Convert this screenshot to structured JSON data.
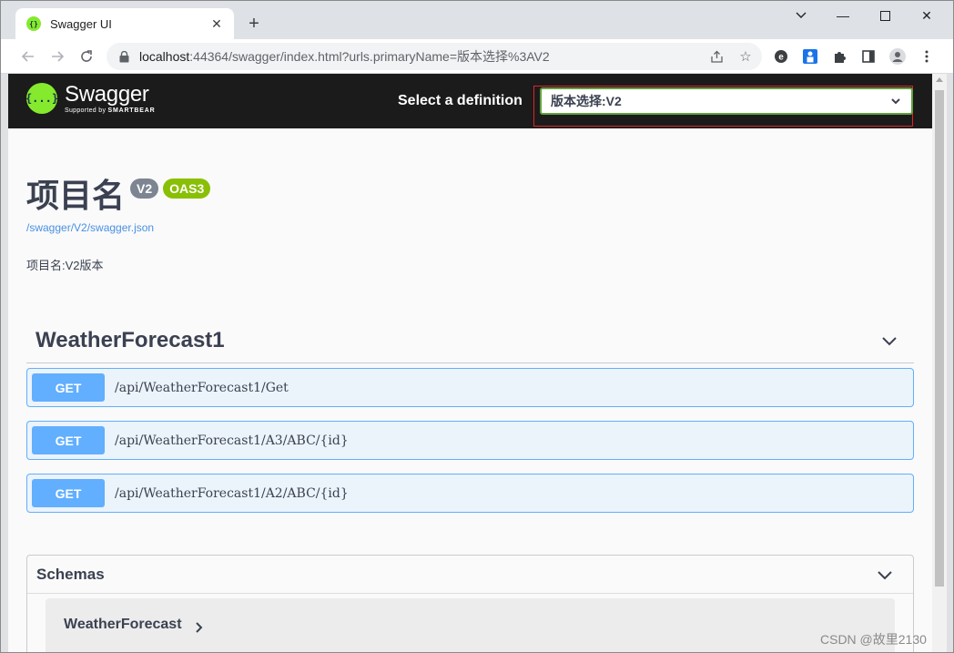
{
  "browser": {
    "tab_title": "Swagger UI",
    "tab_close": "✕",
    "new_tab": "+",
    "url_host": "localhost",
    "url_rest": ":44364/swagger/index.html?urls.primaryName=版本选择%3AV2",
    "window_controls": {
      "minimize": "—",
      "restore": "❐",
      "close": "✕"
    },
    "icons": [
      "back-icon",
      "forward-icon",
      "reload-icon",
      "lock-icon",
      "share-icon",
      "bookmark-star-icon",
      "extension-icon",
      "puzzle-icon",
      "sidebar-icon",
      "profile-icon",
      "more-icon"
    ]
  },
  "topbar": {
    "logo_word": "Swagger",
    "logo_sub_prefix": "Supported by",
    "logo_sub_brand": "SMARTBEAR",
    "logo_mark": "{...}",
    "definition_label": "Select a definition",
    "definition_value": "版本选择:V2",
    "accent_color": "#85ea2d",
    "highlight_color": "#e02424"
  },
  "info": {
    "title": "项目名",
    "version_badge": "V2",
    "oas_badge": "OAS3",
    "spec_link": "/swagger/V2/swagger.json",
    "description": "项目名:V2版本"
  },
  "tag": {
    "name": "WeatherForecast1",
    "operations": [
      {
        "method": "GET",
        "path": "/api/WeatherForecast1/Get"
      },
      {
        "method": "GET",
        "path": "/api/WeatherForecast1/A3/ABC/{id}"
      },
      {
        "method": "GET",
        "path": "/api/WeatherForecast1/A2/ABC/{id}"
      }
    ],
    "get_color": "#61affe"
  },
  "schemas": {
    "title": "Schemas",
    "models": [
      {
        "name": "WeatherForecast"
      }
    ]
  },
  "watermark": "CSDN @故里2130"
}
